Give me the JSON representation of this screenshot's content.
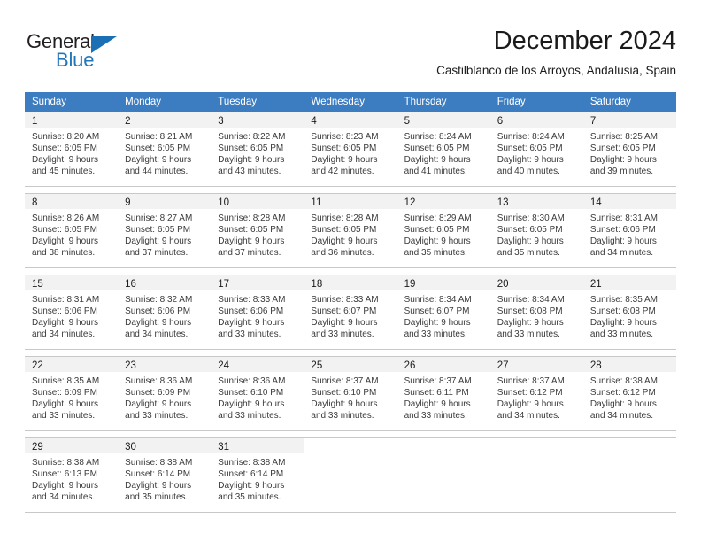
{
  "logo": {
    "word_top": "General",
    "word_bottom": "Blue",
    "triangle_color": "#1a6fb5",
    "blue_color": "#2277bb"
  },
  "header": {
    "title": "December 2024",
    "subtitle": "Castilblanco de los Arroyos, Andalusia, Spain"
  },
  "calendar": {
    "header_color": "#3c7cc0",
    "daynum_band_color": "#f2f2f2",
    "weekdays": [
      "Sunday",
      "Monday",
      "Tuesday",
      "Wednesday",
      "Thursday",
      "Friday",
      "Saturday"
    ],
    "weeks": [
      [
        {
          "day": "1",
          "sunrise": "Sunrise: 8:20 AM",
          "sunset": "Sunset: 6:05 PM",
          "daylight1": "Daylight: 9 hours",
          "daylight2": "and 45 minutes."
        },
        {
          "day": "2",
          "sunrise": "Sunrise: 8:21 AM",
          "sunset": "Sunset: 6:05 PM",
          "daylight1": "Daylight: 9 hours",
          "daylight2": "and 44 minutes."
        },
        {
          "day": "3",
          "sunrise": "Sunrise: 8:22 AM",
          "sunset": "Sunset: 6:05 PM",
          "daylight1": "Daylight: 9 hours",
          "daylight2": "and 43 minutes."
        },
        {
          "day": "4",
          "sunrise": "Sunrise: 8:23 AM",
          "sunset": "Sunset: 6:05 PM",
          "daylight1": "Daylight: 9 hours",
          "daylight2": "and 42 minutes."
        },
        {
          "day": "5",
          "sunrise": "Sunrise: 8:24 AM",
          "sunset": "Sunset: 6:05 PM",
          "daylight1": "Daylight: 9 hours",
          "daylight2": "and 41 minutes."
        },
        {
          "day": "6",
          "sunrise": "Sunrise: 8:24 AM",
          "sunset": "Sunset: 6:05 PM",
          "daylight1": "Daylight: 9 hours",
          "daylight2": "and 40 minutes."
        },
        {
          "day": "7",
          "sunrise": "Sunrise: 8:25 AM",
          "sunset": "Sunset: 6:05 PM",
          "daylight1": "Daylight: 9 hours",
          "daylight2": "and 39 minutes."
        }
      ],
      [
        {
          "day": "8",
          "sunrise": "Sunrise: 8:26 AM",
          "sunset": "Sunset: 6:05 PM",
          "daylight1": "Daylight: 9 hours",
          "daylight2": "and 38 minutes."
        },
        {
          "day": "9",
          "sunrise": "Sunrise: 8:27 AM",
          "sunset": "Sunset: 6:05 PM",
          "daylight1": "Daylight: 9 hours",
          "daylight2": "and 37 minutes."
        },
        {
          "day": "10",
          "sunrise": "Sunrise: 8:28 AM",
          "sunset": "Sunset: 6:05 PM",
          "daylight1": "Daylight: 9 hours",
          "daylight2": "and 37 minutes."
        },
        {
          "day": "11",
          "sunrise": "Sunrise: 8:28 AM",
          "sunset": "Sunset: 6:05 PM",
          "daylight1": "Daylight: 9 hours",
          "daylight2": "and 36 minutes."
        },
        {
          "day": "12",
          "sunrise": "Sunrise: 8:29 AM",
          "sunset": "Sunset: 6:05 PM",
          "daylight1": "Daylight: 9 hours",
          "daylight2": "and 35 minutes."
        },
        {
          "day": "13",
          "sunrise": "Sunrise: 8:30 AM",
          "sunset": "Sunset: 6:05 PM",
          "daylight1": "Daylight: 9 hours",
          "daylight2": "and 35 minutes."
        },
        {
          "day": "14",
          "sunrise": "Sunrise: 8:31 AM",
          "sunset": "Sunset: 6:06 PM",
          "daylight1": "Daylight: 9 hours",
          "daylight2": "and 34 minutes."
        }
      ],
      [
        {
          "day": "15",
          "sunrise": "Sunrise: 8:31 AM",
          "sunset": "Sunset: 6:06 PM",
          "daylight1": "Daylight: 9 hours",
          "daylight2": "and 34 minutes."
        },
        {
          "day": "16",
          "sunrise": "Sunrise: 8:32 AM",
          "sunset": "Sunset: 6:06 PM",
          "daylight1": "Daylight: 9 hours",
          "daylight2": "and 34 minutes."
        },
        {
          "day": "17",
          "sunrise": "Sunrise: 8:33 AM",
          "sunset": "Sunset: 6:06 PM",
          "daylight1": "Daylight: 9 hours",
          "daylight2": "and 33 minutes."
        },
        {
          "day": "18",
          "sunrise": "Sunrise: 8:33 AM",
          "sunset": "Sunset: 6:07 PM",
          "daylight1": "Daylight: 9 hours",
          "daylight2": "and 33 minutes."
        },
        {
          "day": "19",
          "sunrise": "Sunrise: 8:34 AM",
          "sunset": "Sunset: 6:07 PM",
          "daylight1": "Daylight: 9 hours",
          "daylight2": "and 33 minutes."
        },
        {
          "day": "20",
          "sunrise": "Sunrise: 8:34 AM",
          "sunset": "Sunset: 6:08 PM",
          "daylight1": "Daylight: 9 hours",
          "daylight2": "and 33 minutes."
        },
        {
          "day": "21",
          "sunrise": "Sunrise: 8:35 AM",
          "sunset": "Sunset: 6:08 PM",
          "daylight1": "Daylight: 9 hours",
          "daylight2": "and 33 minutes."
        }
      ],
      [
        {
          "day": "22",
          "sunrise": "Sunrise: 8:35 AM",
          "sunset": "Sunset: 6:09 PM",
          "daylight1": "Daylight: 9 hours",
          "daylight2": "and 33 minutes."
        },
        {
          "day": "23",
          "sunrise": "Sunrise: 8:36 AM",
          "sunset": "Sunset: 6:09 PM",
          "daylight1": "Daylight: 9 hours",
          "daylight2": "and 33 minutes."
        },
        {
          "day": "24",
          "sunrise": "Sunrise: 8:36 AM",
          "sunset": "Sunset: 6:10 PM",
          "daylight1": "Daylight: 9 hours",
          "daylight2": "and 33 minutes."
        },
        {
          "day": "25",
          "sunrise": "Sunrise: 8:37 AM",
          "sunset": "Sunset: 6:10 PM",
          "daylight1": "Daylight: 9 hours",
          "daylight2": "and 33 minutes."
        },
        {
          "day": "26",
          "sunrise": "Sunrise: 8:37 AM",
          "sunset": "Sunset: 6:11 PM",
          "daylight1": "Daylight: 9 hours",
          "daylight2": "and 33 minutes."
        },
        {
          "day": "27",
          "sunrise": "Sunrise: 8:37 AM",
          "sunset": "Sunset: 6:12 PM",
          "daylight1": "Daylight: 9 hours",
          "daylight2": "and 34 minutes."
        },
        {
          "day": "28",
          "sunrise": "Sunrise: 8:38 AM",
          "sunset": "Sunset: 6:12 PM",
          "daylight1": "Daylight: 9 hours",
          "daylight2": "and 34 minutes."
        }
      ],
      [
        {
          "day": "29",
          "sunrise": "Sunrise: 8:38 AM",
          "sunset": "Sunset: 6:13 PM",
          "daylight1": "Daylight: 9 hours",
          "daylight2": "and 34 minutes."
        },
        {
          "day": "30",
          "sunrise": "Sunrise: 8:38 AM",
          "sunset": "Sunset: 6:14 PM",
          "daylight1": "Daylight: 9 hours",
          "daylight2": "and 35 minutes."
        },
        {
          "day": "31",
          "sunrise": "Sunrise: 8:38 AM",
          "sunset": "Sunset: 6:14 PM",
          "daylight1": "Daylight: 9 hours",
          "daylight2": "and 35 minutes."
        },
        {
          "day": "",
          "sunrise": "",
          "sunset": "",
          "daylight1": "",
          "daylight2": ""
        },
        {
          "day": "",
          "sunrise": "",
          "sunset": "",
          "daylight1": "",
          "daylight2": ""
        },
        {
          "day": "",
          "sunrise": "",
          "sunset": "",
          "daylight1": "",
          "daylight2": ""
        },
        {
          "day": "",
          "sunrise": "",
          "sunset": "",
          "daylight1": "",
          "daylight2": ""
        }
      ]
    ]
  }
}
